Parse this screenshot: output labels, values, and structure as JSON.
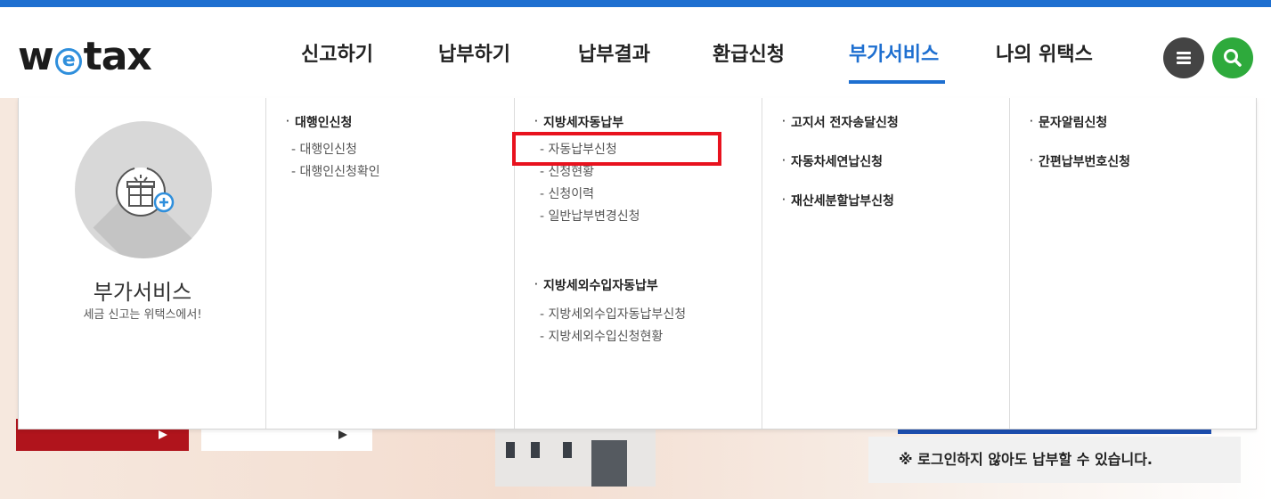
{
  "brand": {
    "logo_pre": "w",
    "logo_e": "e",
    "logo_post": "tax",
    "accent": "#1e6fd0",
    "search_color": "#2eaa3c",
    "highlight_color": "#e8121e"
  },
  "nav": {
    "items": [
      {
        "label": "신고하기"
      },
      {
        "label": "납부하기"
      },
      {
        "label": "납부결과"
      },
      {
        "label": "환급신청"
      },
      {
        "label": "부가서비스",
        "active": true
      },
      {
        "label": "나의 위택스"
      }
    ],
    "menu_icon": "hamburger-icon",
    "search_icon": "search-icon"
  },
  "mega": {
    "intro": {
      "title": "부가서비스",
      "subtitle": "세금 신고는 위택스에서!",
      "icon": "gift-plus-icon"
    },
    "col2": {
      "cat1": "대행인신청",
      "cat1_items": [
        "대행인신청",
        "대행인신청확인"
      ]
    },
    "col3": {
      "cat1": "지방세자동납부",
      "cat1_items": [
        "자동납부신청",
        "신청현황",
        "신청이력",
        "일반납부변경신청"
      ],
      "cat2": "지방세외수입자동납부",
      "cat2_items": [
        "지방세외수입자동납부신청",
        "지방세외수입신청현황"
      ]
    },
    "col4": {
      "cats": [
        "고지서 전자송달신청",
        "자동차세연납신청",
        "재산세분할납부신청"
      ]
    },
    "col5": {
      "cats": [
        "문자알림신청",
        "간편납부번호신청"
      ]
    }
  },
  "background": {
    "notice": "※ 로그인하지 않아도 납부할 수 있습니다."
  }
}
